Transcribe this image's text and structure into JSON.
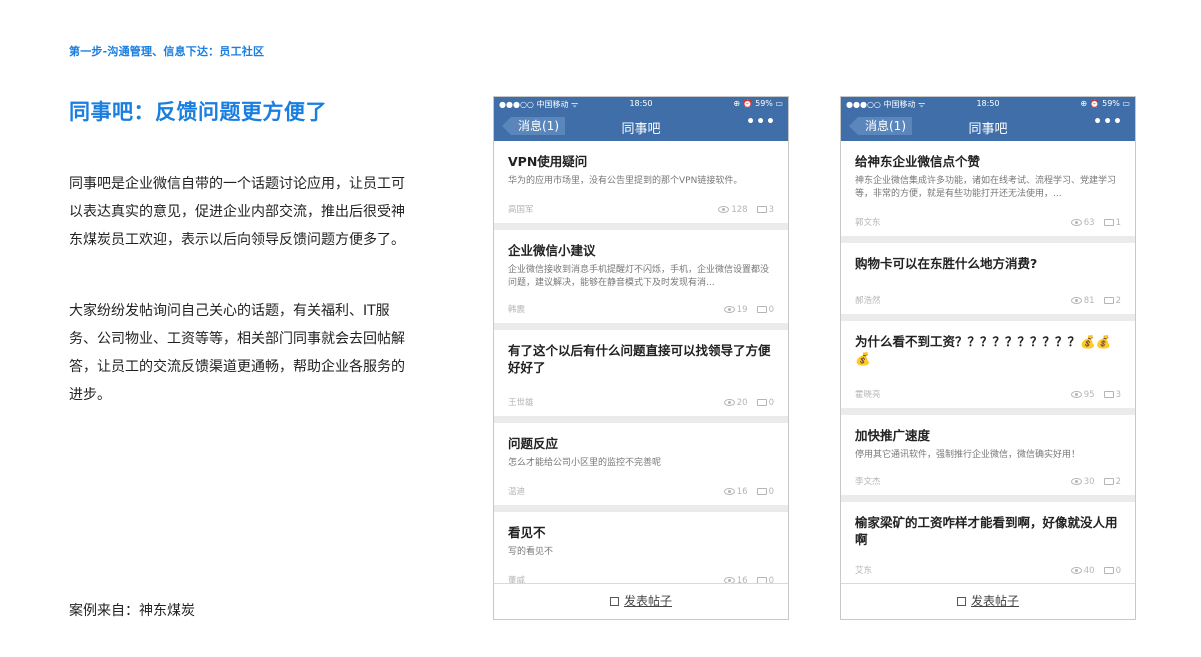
{
  "slide": {
    "step": "第一步-沟通管理、信息下达：员工社区",
    "title": "同事吧：反馈问题更方便了",
    "paragraph1": "同事吧是企业微信自带的一个话题讨论应用，让员工可以表达真实的意见，促进企业内部交流，推出后很受神东煤炭员工欢迎，表示以后向领导反馈问题方便多了。",
    "paragraph2": "大家纷纷发帖询问自己关心的话题，有关福利、IT服务、公司物业、工资等等，相关部门同事就会去回帖解答，让员工的交流反馈渠道更通畅，帮助企业各服务的进步。",
    "source": "案例来自：神东煤炭"
  },
  "colors": {
    "accent": "#1a7ee0",
    "navbar": "#3f6ea8"
  },
  "phone_left": {
    "status": {
      "carrier": "●●●○○ 中国移动 ᯤ",
      "time": "18:50",
      "battery": "⊕ ⏰ 59% ▭"
    },
    "nav": {
      "back": "消息(1)",
      "title": "同事吧",
      "more": "•••"
    },
    "posts": [
      {
        "title": "VPN使用疑问",
        "excerpt": "华为的应用市场里，没有公告里提到的那个VPN链接软件。",
        "author": "高国军",
        "views": "128",
        "comments": "3"
      },
      {
        "title": "企业微信小建议",
        "excerpt": "企业微信接收到消息手机提醒灯不闪烁，手机，企业微信设置都没问题，建议解决，能够在静音模式下及时发现有消...",
        "author": "韩震",
        "views": "19",
        "comments": "0"
      },
      {
        "title": "有了这个以后有什么问题直接可以找领导了方便好好了",
        "excerpt": "",
        "author": "王世雄",
        "views": "20",
        "comments": "0"
      },
      {
        "title": "问题反应",
        "excerpt": "怎么才能给公司小区里的监控不完善呢",
        "author": "温迪",
        "views": "16",
        "comments": "0"
      },
      {
        "title": "看见不",
        "excerpt": "写的看见不",
        "author": "董威",
        "views": "16",
        "comments": "0"
      }
    ],
    "composer": "发表帖子"
  },
  "phone_right": {
    "status": {
      "carrier": "●●●○○ 中国移动 ᯤ",
      "time": "18:50",
      "battery": "⊕ ⏰ 59% ▭"
    },
    "nav": {
      "back": "消息(1)",
      "title": "同事吧",
      "more": "•••"
    },
    "posts": [
      {
        "title": "给神东企业微信点个赞",
        "excerpt": "神东企业微信集成许多功能，诸如在线考试、流程学习、党建学习等，非常的方便，就是有些功能打开还无法使用，...",
        "author": "郭文东",
        "views": "63",
        "comments": "1"
      },
      {
        "title": "购物卡可以在东胜什么地方消费?",
        "excerpt": "",
        "author": "郝浩然",
        "views": "81",
        "comments": "2"
      },
      {
        "title": "为什么看不到工资？？？？？？？？？？💰💰💰",
        "excerpt": "",
        "author": "霍晓亮",
        "views": "95",
        "comments": "3"
      },
      {
        "title": "加快推广速度",
        "excerpt": "停用其它通讯软件，强制推行企业微信，微信确实好用！",
        "author": "李文杰",
        "views": "30",
        "comments": "2"
      },
      {
        "title": "榆家梁矿的工资咋样才能看到啊，好像就没人用啊",
        "excerpt": "",
        "author": "艾东",
        "views": "40",
        "comments": "0"
      }
    ],
    "composer": "发表帖子"
  }
}
